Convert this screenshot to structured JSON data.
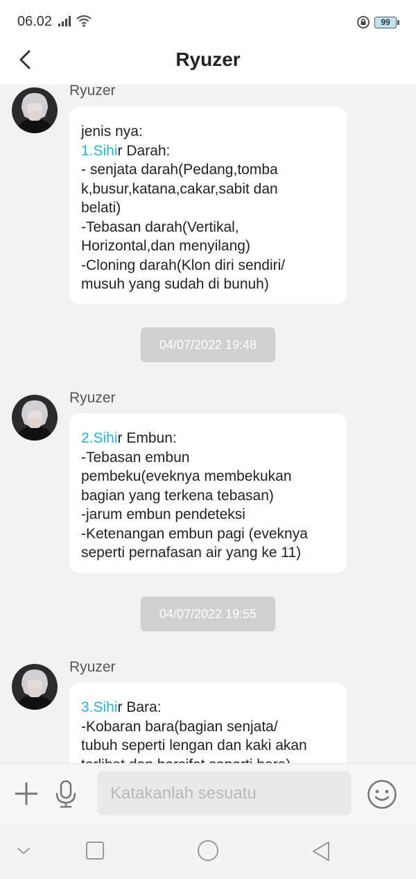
{
  "status": {
    "time": "06.02",
    "battery": "99"
  },
  "header": {
    "title": "Ryuzer"
  },
  "messages": [
    {
      "sender": "Ryuzer",
      "lines": [
        "jenis nya:",
        "",
        "- senjata darah(Pedang,tomba",
        "k,busur,katana,cakar,sabit dan",
        "belati)",
        "-Tebasan darah(Vertikal,",
        "Horizontal,dan menyilang)",
        "-Cloning darah(Klon diri sendiri/",
        "musuh yang sudah di bunuh)"
      ],
      "highlight": "1.Sihi",
      "highlight_rest": "r Darah:"
    },
    {
      "sender": "Ryuzer",
      "lines": [
        "",
        "-Tebasan embun",
        "pembeku(eveknya membekukan",
        "bagian yang terkena tebasan)",
        "-jarum embun pendeteksi",
        "-Ketenangan embun pagi (eveknya",
        "seperti pernafasan air yang ke 11)"
      ],
      "highlight": "2.Sihi",
      "highlight_rest": "r Embun:"
    },
    {
      "sender": "Ryuzer",
      "lines": [
        "",
        "-Kobaran bara(bagian senjata/",
        "tubuh seperti lengan dan kaki akan",
        "terlihat dan bersifat seperti bara)"
      ],
      "highlight": "3.Sihi",
      "highlight_rest": "r Bara:"
    }
  ],
  "timestamps": [
    "04/07/2022 19:48",
    "04/07/2022 19:55"
  ],
  "input": {
    "placeholder": "Katakanlah sesuatu"
  },
  "icons": {
    "back": "chevron-left-icon",
    "add": "plus-icon",
    "voice": "microphone-icon",
    "emoji": "smiley-icon",
    "nav": [
      "chevron-down-icon",
      "square-icon",
      "circle-icon",
      "triangle-back-icon"
    ]
  },
  "colors": {
    "highlight": "#2bb0d6",
    "timestamp_bg": "#d0d0d0",
    "chat_bg": "#f2f2f2"
  }
}
